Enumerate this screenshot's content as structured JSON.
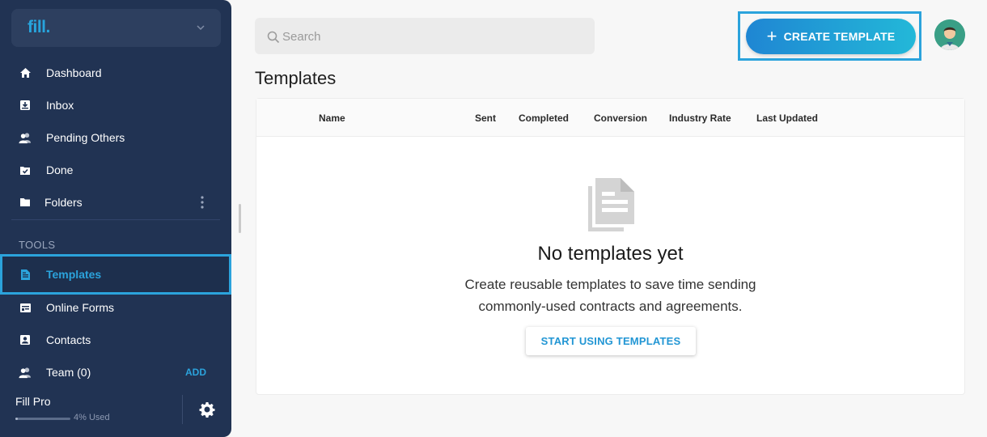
{
  "app": {
    "logo_text": "fill."
  },
  "sidebar": {
    "items": [
      {
        "label": "Dashboard",
        "icon": "home-icon"
      },
      {
        "label": "Inbox",
        "icon": "inbox-icon"
      },
      {
        "label": "Pending Others",
        "icon": "users-icon"
      },
      {
        "label": "Done",
        "icon": "done-icon"
      },
      {
        "label": "Folders",
        "icon": "folder-icon"
      }
    ],
    "section_label": "TOOLS",
    "tools": [
      {
        "label": "Templates",
        "icon": "template-icon",
        "active": true
      },
      {
        "label": "Online Forms",
        "icon": "form-icon"
      },
      {
        "label": "Contacts",
        "icon": "contact-icon"
      },
      {
        "label": "Team (0)",
        "icon": "team-icon",
        "action": "ADD"
      }
    ],
    "plan": {
      "name": "Fill Pro",
      "usage_text": "4% Used",
      "usage_fraction": 0.04
    }
  },
  "header": {
    "search_placeholder": "Search",
    "create_button_label": "CREATE TEMPLATE",
    "create_button_plus": "+"
  },
  "main": {
    "title": "Templates",
    "columns": [
      "Name",
      "Sent",
      "Completed",
      "Conversion",
      "Industry Rate",
      "Last Updated"
    ],
    "empty_state": {
      "title": "No templates yet",
      "description_line1": "Create reusable templates to save time sending",
      "description_line2": "commonly-used contracts and agreements.",
      "button_label": "START USING TEMPLATES"
    }
  },
  "colors": {
    "sidebar_bg": "#213353",
    "accent": "#2ba3dc",
    "button_gradient_start": "#1f86d3",
    "button_gradient_end": "#23b8d8"
  }
}
